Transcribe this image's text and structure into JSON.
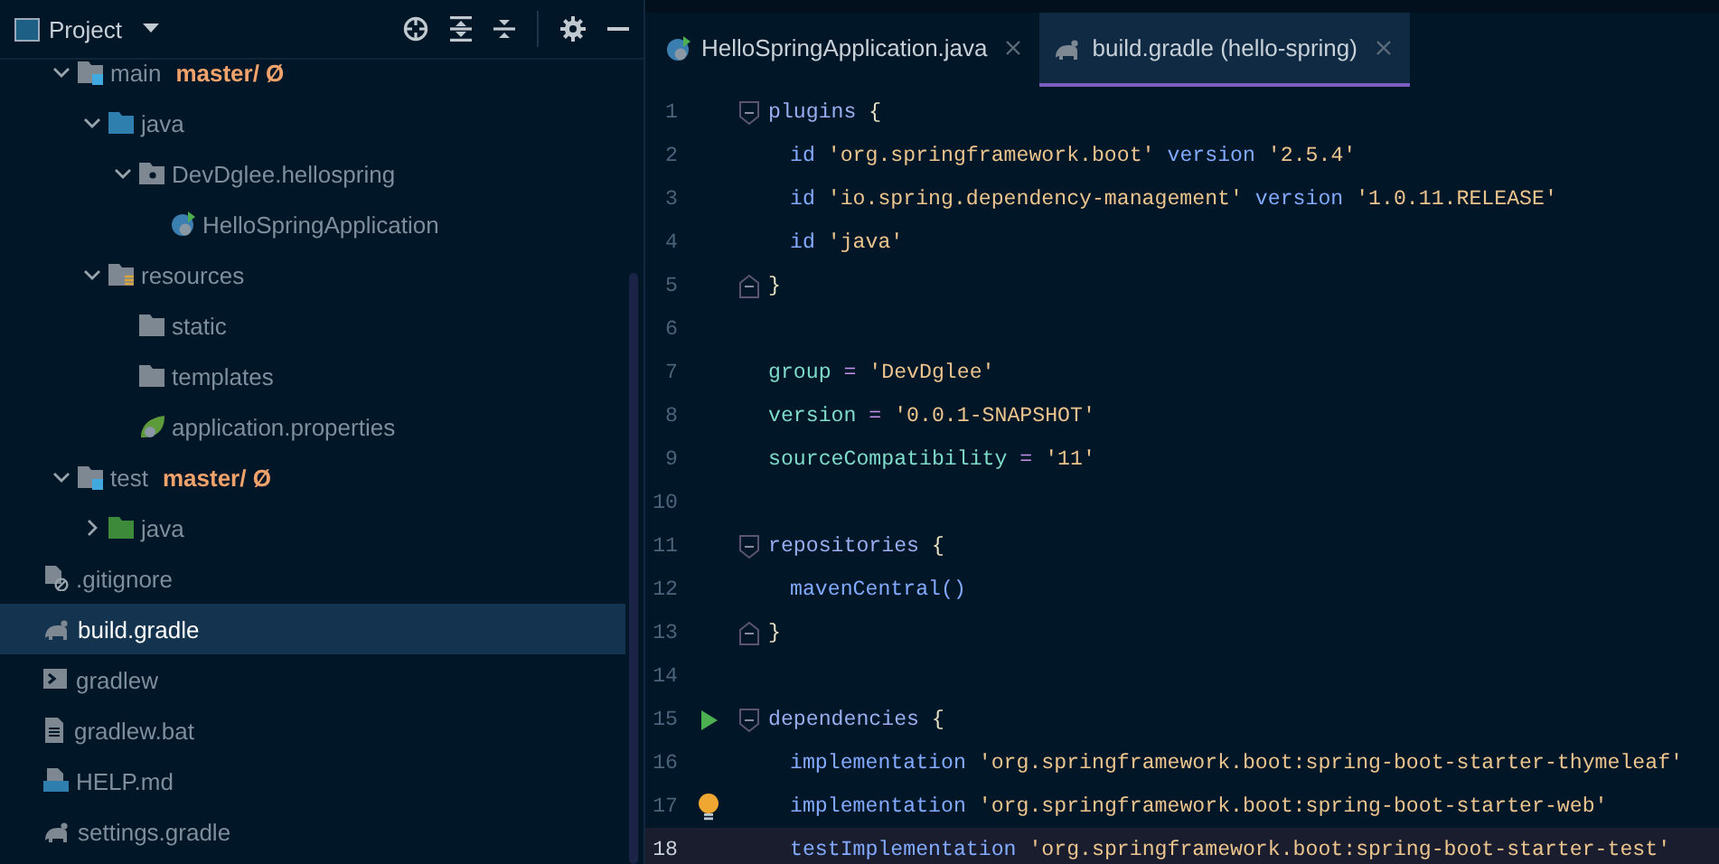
{
  "project_panel": {
    "title": "Project"
  },
  "tree": [
    {
      "label": "main",
      "kind": "module",
      "branch": "master/ Ø",
      "expanded": true,
      "selected": false,
      "children": [
        {
          "label": "java",
          "kind": "source",
          "expanded": true,
          "selected": false,
          "children": [
            {
              "label": "DevDglee.hellospring",
              "kind": "package",
              "expanded": true,
              "selected": false,
              "children": [
                {
                  "label": "HelloSpringApplication",
                  "kind": "spring",
                  "selected": false
                }
              ]
            }
          ]
        },
        {
          "label": "resources",
          "kind": "resources",
          "expanded": true,
          "selected": false,
          "children": [
            {
              "label": "static",
              "kind": "folder",
              "selected": false
            },
            {
              "label": "templates",
              "kind": "folder",
              "selected": false
            },
            {
              "label": "application.properties",
              "kind": "properties",
              "selected": false
            }
          ]
        }
      ]
    },
    {
      "label": "test",
      "kind": "module",
      "branch": "master/ Ø",
      "expanded": true,
      "selected": false,
      "children": [
        {
          "label": "java",
          "kind": "test",
          "expanded": false,
          "selected": false
        }
      ]
    },
    {
      "label": ".gitignore",
      "kind": "ignore",
      "selected": false
    },
    {
      "label": "build.gradle",
      "kind": "gradle",
      "selected": true
    },
    {
      "label": "gradlew",
      "kind": "shell",
      "selected": false
    },
    {
      "label": "gradlew.bat",
      "kind": "text",
      "selected": false
    },
    {
      "label": "HELP.md",
      "kind": "markdown",
      "selected": false
    },
    {
      "label": "settings.gradle",
      "kind": "gradle",
      "selected": false
    }
  ],
  "tabs": [
    {
      "label": "HelloSpringApplication.java",
      "kind": "spring",
      "selected": false
    },
    {
      "label": "build.gradle (hello-spring)",
      "kind": "gradle",
      "selected": true
    }
  ],
  "editor": {
    "lines": [
      {
        "number": "1",
        "fold_start": true,
        "current": false,
        "tokens": [
          {
            "kind": "block",
            "text": "plugins"
          },
          {
            "kind": "brace",
            "text": " {"
          }
        ]
      },
      {
        "number": "2",
        "indented": true,
        "current": false,
        "tokens": [
          {
            "kind": "keyword",
            "text": "id "
          },
          {
            "kind": "string",
            "text": "'org.springframework.boot'"
          },
          {
            "kind": "keyword",
            "text": " version "
          },
          {
            "kind": "string",
            "text": "'2.5.4'"
          }
        ]
      },
      {
        "number": "3",
        "indented": true,
        "current": false,
        "tokens": [
          {
            "kind": "keyword",
            "text": "id "
          },
          {
            "kind": "string",
            "text": "'io.spring.dependency-management'"
          },
          {
            "kind": "keyword",
            "text": " version "
          },
          {
            "kind": "string",
            "text": "'1.0.11.RELEASE'"
          }
        ]
      },
      {
        "number": "4",
        "indented": true,
        "current": false,
        "tokens": [
          {
            "kind": "keyword",
            "text": "id "
          },
          {
            "kind": "string",
            "text": "'java'"
          }
        ]
      },
      {
        "number": "5",
        "fold_end": true,
        "current": false,
        "tokens": [
          {
            "kind": "brace",
            "text": "}"
          }
        ]
      },
      {
        "number": "6",
        "current": false
      },
      {
        "number": "7",
        "current": false,
        "tokens": [
          {
            "kind": "property",
            "text": "group"
          },
          {
            "kind": "op",
            "text": " = "
          },
          {
            "kind": "string",
            "text": "'DevDglee'"
          }
        ]
      },
      {
        "number": "8",
        "current": false,
        "tokens": [
          {
            "kind": "property",
            "text": "version"
          },
          {
            "kind": "op",
            "text": " = "
          },
          {
            "kind": "string",
            "text": "'0.0.1-SNAPSHOT'"
          }
        ]
      },
      {
        "number": "9",
        "current": false,
        "tokens": [
          {
            "kind": "property",
            "text": "sourceCompatibility"
          },
          {
            "kind": "op",
            "text": " = "
          },
          {
            "kind": "string",
            "text": "'11'"
          }
        ]
      },
      {
        "number": "10",
        "current": false
      },
      {
        "number": "11",
        "fold_start": true,
        "current": false,
        "tokens": [
          {
            "kind": "block",
            "text": "repositories"
          },
          {
            "kind": "brace",
            "text": " {"
          }
        ]
      },
      {
        "number": "12",
        "indented": true,
        "current": false,
        "tokens": [
          {
            "kind": "keyword",
            "text": "mavenCentral()"
          }
        ]
      },
      {
        "number": "13",
        "fold_end": true,
        "current": false,
        "tokens": [
          {
            "kind": "brace",
            "text": "}"
          }
        ]
      },
      {
        "number": "14",
        "current": false
      },
      {
        "number": "15",
        "fold_start": true,
        "runnable": true,
        "current": false,
        "tokens": [
          {
            "kind": "block",
            "text": "dependencies"
          },
          {
            "kind": "brace",
            "text": " {"
          }
        ]
      },
      {
        "number": "16",
        "indented": true,
        "current": false,
        "tokens": [
          {
            "kind": "keyword",
            "text": "implementation "
          },
          {
            "kind": "string",
            "text": "'org.springframework.boot:spring-boot-starter-thymeleaf'"
          }
        ]
      },
      {
        "number": "17",
        "indented": true,
        "hint": true,
        "current": false,
        "tokens": [
          {
            "kind": "keyword",
            "text": "implementation "
          },
          {
            "kind": "string",
            "text": "'org.springframework.boot:spring-boot-starter-web'"
          }
        ]
      },
      {
        "number": "18",
        "indented": true,
        "current": true,
        "tokens": [
          {
            "kind": "keyword",
            "text": "testImplementation "
          },
          {
            "kind": "string",
            "text": "'org.springframework.boot:spring-boot-starter-test'"
          }
        ]
      }
    ]
  }
}
